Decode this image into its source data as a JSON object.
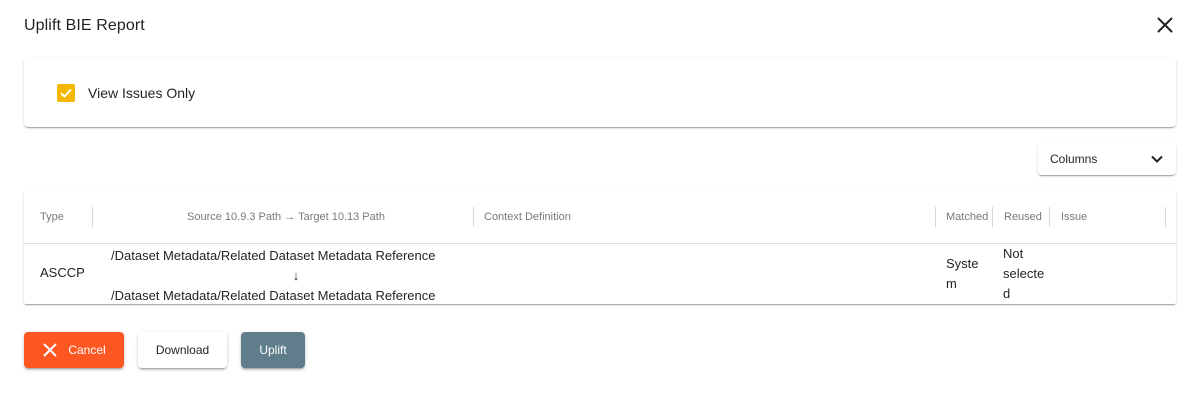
{
  "dialog": {
    "title": "Uplift BIE Report"
  },
  "filter": {
    "view_issues_only_label": "View Issues Only",
    "view_issues_only_checked": true,
    "checkbox_color": "#f5b800"
  },
  "columns_menu": {
    "label": "Columns"
  },
  "table": {
    "headers": {
      "type": "Type",
      "path": "Source 10.9.3 Path → Target 10.13 Path",
      "context_definition": "Context Definition",
      "matched": "Matched",
      "reused": "Reused",
      "issue": "Issue"
    },
    "rows": [
      {
        "type": "ASCCP",
        "source_path": "/Dataset Metadata/Related Dataset Metadata Reference",
        "arrow": "↓",
        "target_path": "/Dataset Metadata/Related Dataset Metadata Reference",
        "context_definition": "",
        "matched": "System",
        "reused": "Not selected",
        "issue": ""
      }
    ]
  },
  "actions": {
    "cancel_label": "Cancel",
    "download_label": "Download",
    "uplift_label": "Uplift"
  },
  "colors": {
    "cancel": "#ff5722",
    "uplift": "#607d8b"
  }
}
